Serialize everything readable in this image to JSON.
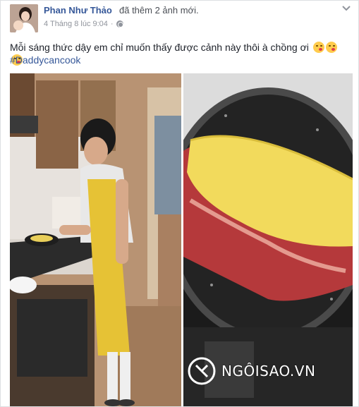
{
  "post": {
    "author": "Phan Như Thảo",
    "action": "đã thêm 2 ảnh mới.",
    "timestamp": "4 Tháng 8 lúc 9:04",
    "audience_icon": "globe-icon",
    "menu_icon": "chevron-down-icon",
    "caption": "Mỗi sáng thức dậy em chỉ muốn thấy được cảnh này thôi à chồng ơi",
    "emojis": [
      "kissing-face-emoji",
      "kissing-face-emoji",
      "kissing-face-emoji"
    ],
    "hashtag": "#Daddycancook"
  },
  "photos": [
    {
      "name": "man-cooking-in-kitchen-photo"
    },
    {
      "name": "omelette-in-pan-photo"
    }
  ],
  "watermark": {
    "text": "NGÔISAO.VN"
  },
  "colors": {
    "link": "#365899",
    "text": "#1d2129",
    "meta": "#90949c"
  }
}
